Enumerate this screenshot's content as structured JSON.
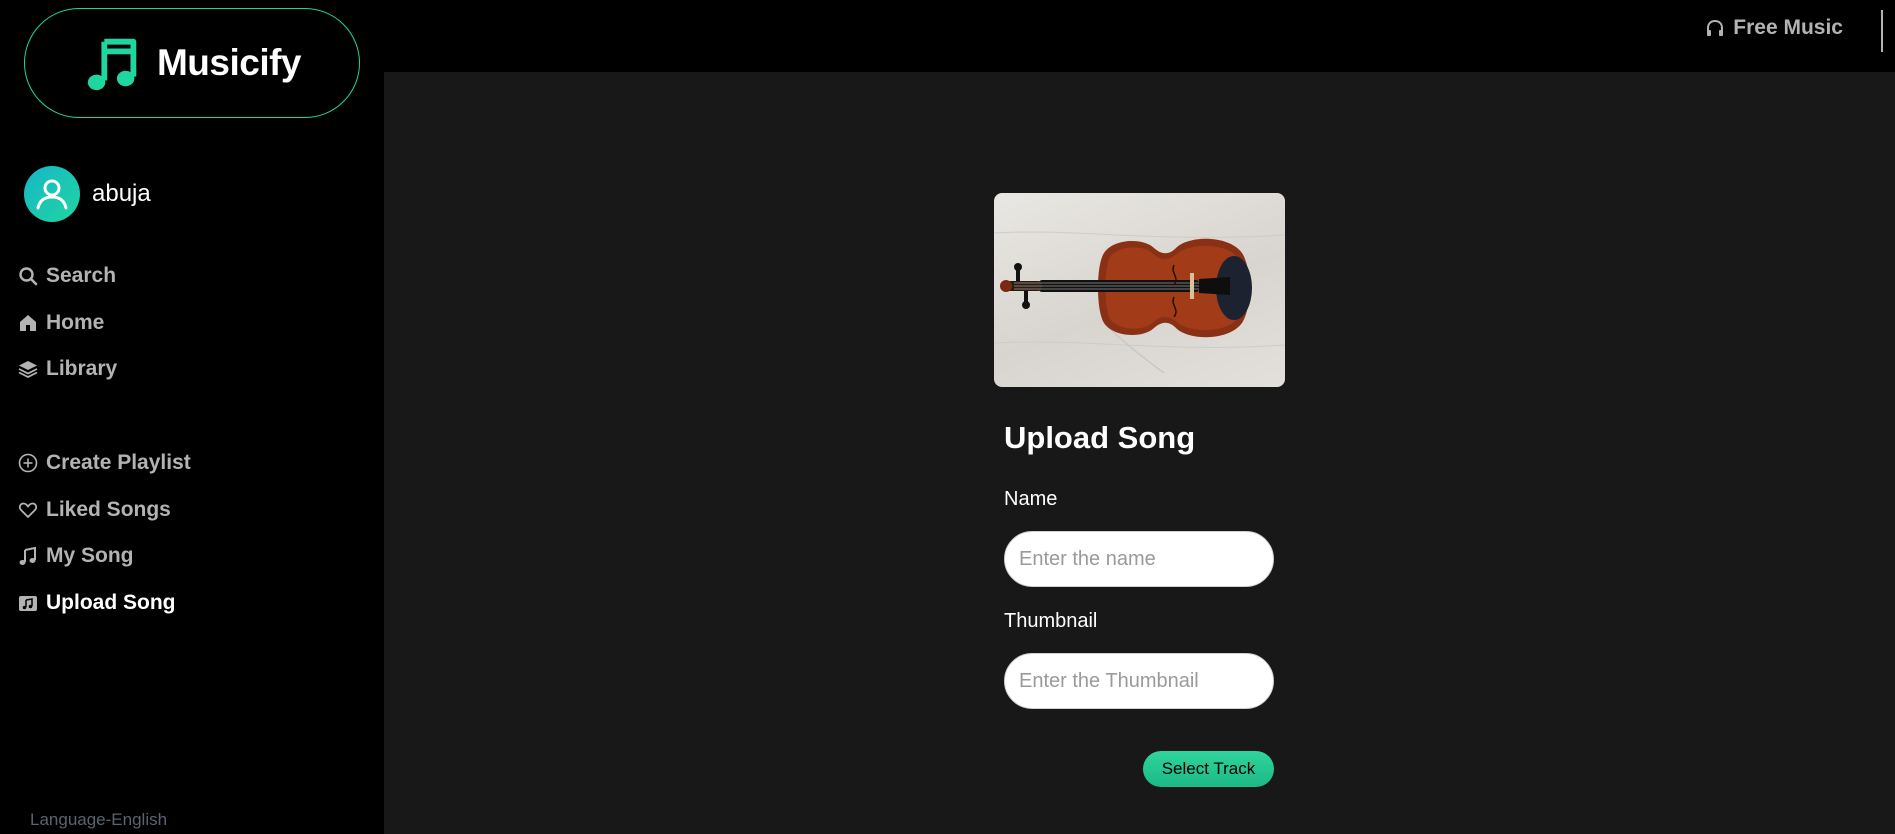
{
  "app": {
    "name": "Musicify"
  },
  "colors": {
    "accent": "#1fd6a0",
    "sidebar_bg": "#000000",
    "main_bg": "#181818",
    "nav_text": "#b3b3b3"
  },
  "user": {
    "name": "abuja"
  },
  "nav": {
    "main": [
      {
        "label": "Search",
        "icon": "search-icon"
      },
      {
        "label": "Home",
        "icon": "home-icon"
      },
      {
        "label": "Library",
        "icon": "library-icon"
      }
    ],
    "library": [
      {
        "label": "Create Playlist",
        "icon": "plus-circle-icon"
      },
      {
        "label": "Liked Songs",
        "icon": "heart-icon"
      },
      {
        "label": "My Song",
        "icon": "music-note-icon"
      },
      {
        "label": "Upload Song",
        "icon": "music-file-icon",
        "active": true
      }
    ]
  },
  "footer": {
    "language": "Language-English"
  },
  "topbar": {
    "free_music": "Free Music"
  },
  "upload": {
    "title": "Upload Song",
    "name_label": "Name",
    "name_placeholder": "Enter the name",
    "thumbnail_label": "Thumbnail",
    "thumbnail_placeholder": "Enter the Thumbnail",
    "select_track": "Select Track"
  }
}
